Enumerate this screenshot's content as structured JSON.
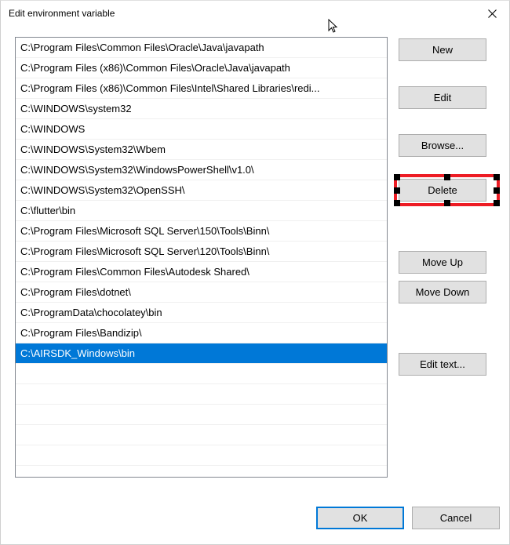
{
  "window": {
    "title": "Edit environment variable"
  },
  "paths": [
    "C:\\Program Files\\Common Files\\Oracle\\Java\\javapath",
    "C:\\Program Files (x86)\\Common Files\\Oracle\\Java\\javapath",
    "C:\\Program Files (x86)\\Common Files\\Intel\\Shared Libraries\\redi...",
    "C:\\WINDOWS\\system32",
    "C:\\WINDOWS",
    "C:\\WINDOWS\\System32\\Wbem",
    "C:\\WINDOWS\\System32\\WindowsPowerShell\\v1.0\\",
    "C:\\WINDOWS\\System32\\OpenSSH\\",
    "C:\\flutter\\bin",
    "C:\\Program Files\\Microsoft SQL Server\\150\\Tools\\Binn\\",
    "C:\\Program Files\\Microsoft SQL Server\\120\\Tools\\Binn\\",
    "C:\\Program Files\\Common Files\\Autodesk Shared\\",
    "C:\\Program Files\\dotnet\\",
    "C:\\ProgramData\\chocolatey\\bin",
    "C:\\Program Files\\Bandizip\\",
    "C:\\AIRSDK_Windows\\bin"
  ],
  "selected_index": 15,
  "buttons": {
    "new": "New",
    "edit": "Edit",
    "browse": "Browse...",
    "delete": "Delete",
    "move_up": "Move Up",
    "move_down": "Move Down",
    "edit_text": "Edit text...",
    "ok": "OK",
    "cancel": "Cancel"
  }
}
